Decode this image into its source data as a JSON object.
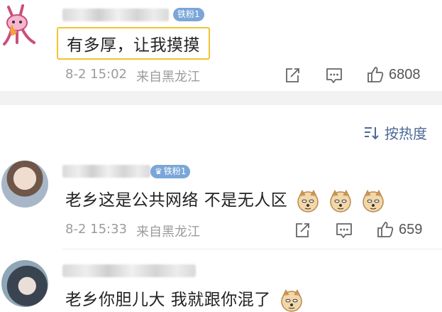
{
  "comments": [
    {
      "badge": "铁粉1",
      "text": "有多厚，让我摸摸",
      "time": "8-2 15:02",
      "source": "来自黑龙江",
      "likes": "6808"
    },
    {
      "badge": "铁粉1",
      "text": "老乡这是公共网络 不是无人区",
      "time": "8-2 15:33",
      "source": "来自黑龙江",
      "likes": "659",
      "emoji_count": 3
    },
    {
      "text": "老乡你胆儿大 我就跟你混了",
      "emoji_count": 1
    }
  ],
  "sort": {
    "label": "按热度",
    "icon": "sort-icon"
  },
  "colors": {
    "highlight_border": "#f2c231",
    "badge": "#7aa6d8",
    "meta_text": "#9b9b9b",
    "sort_text": "#4d6a96",
    "band": "#f2f2f2"
  }
}
